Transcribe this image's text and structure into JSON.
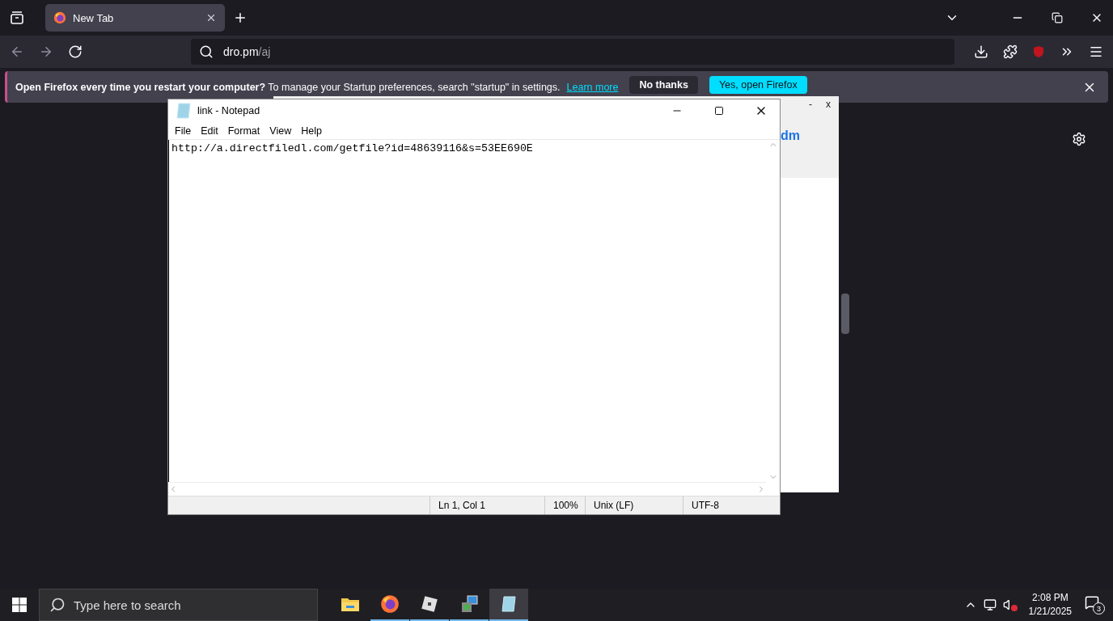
{
  "browser": {
    "tabs": [
      {
        "title": "New Tab",
        "selected": true
      }
    ],
    "address": {
      "host": "dro.pm",
      "path": "/aj"
    }
  },
  "notification": {
    "message": "**Open Firefox every time you restart your computer?** To manage your Startup preferences, search \"startup\" in settings.",
    "link": "Learn more",
    "buttons": [
      {
        "label": "No thanks",
        "kind": "secondary"
      },
      {
        "label": "Yes, open Firefox",
        "kind": "primary"
      }
    ]
  },
  "background_window": {
    "minimize": "-",
    "close": "x",
    "text": "dm"
  },
  "notepad": {
    "title": "link - Notepad",
    "menu": [
      "File",
      "Edit",
      "Format",
      "View",
      "Help"
    ],
    "content": "http://a.directfiledl.com/getfile?id=48639116&s=53EE690E",
    "status": [
      "Ln 1, Col 1",
      "100%",
      "Unix (LF)",
      "UTF-8"
    ]
  },
  "taskbar": {
    "search_placeholder": "Type here to search",
    "apps": [
      {
        "kind": "folder",
        "running": false,
        "selected": false
      },
      {
        "kind": "firefox",
        "running": true,
        "selected": false
      },
      {
        "kind": "cube",
        "running": true,
        "selected": false
      },
      {
        "kind": "setup",
        "running": true,
        "selected": false
      },
      {
        "kind": "notepad",
        "running": true,
        "selected": true
      }
    ],
    "time": "2:08 PM",
    "date": "1/21/2025",
    "notifications": "3"
  }
}
